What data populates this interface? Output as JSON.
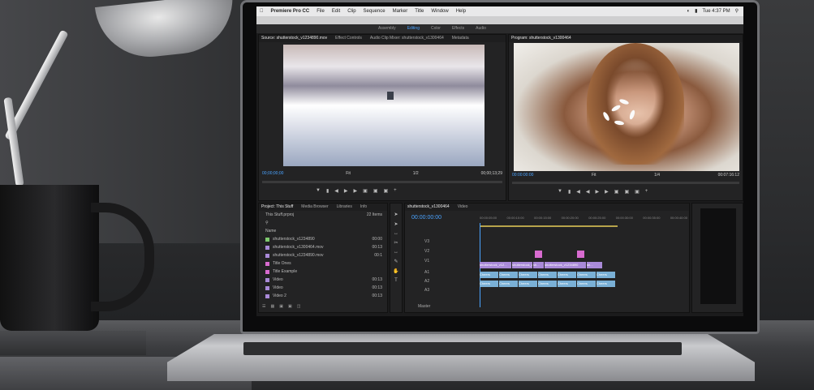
{
  "menubar": {
    "apple": "",
    "app_name": "Premiere Pro CC",
    "menus": [
      "File",
      "Edit",
      "Clip",
      "Sequence",
      "Marker",
      "Title",
      "Window",
      "Help"
    ],
    "clock": "Tue 4:37 PM"
  },
  "workspace_tabs": [
    "Assembly",
    "Editing",
    "Color",
    "Effects",
    "Audio"
  ],
  "source_monitor": {
    "tabs": [
      "Source: shutterstock_v1234890.mov",
      "Effect Controls",
      "Audio Clip Mixer: shutterstock_v1300464",
      "Metadata"
    ],
    "timecode_in": "00;00;00;00",
    "fit": "Fit",
    "zoom": "1/2",
    "timecode_out": "00;00;13;29"
  },
  "program_monitor": {
    "tabs": [
      "Program: shutterstock_v1300464"
    ],
    "timecode_in": "00:00:00:00",
    "fit": "Fit",
    "zoom": "1/4",
    "timecode_out": "00:07:16:12"
  },
  "project_panel": {
    "tabs": [
      "Project: This Stuff",
      "Media Browser",
      "Libraries",
      "Info"
    ],
    "project_file": "This Stuff.prproj",
    "item_count": "22 Items",
    "column_name": "Name",
    "items": [
      {
        "name": "shutterstock_v1234890",
        "dur": "00:00",
        "color": "#7ec96e"
      },
      {
        "name": "shutterstock_v1300464.mov",
        "dur": "00:13",
        "color": "#a98ad8"
      },
      {
        "name": "shutterstock_v1234890.mov",
        "dur": "00:1",
        "color": "#a98ad8"
      },
      {
        "name": "Title Ones",
        "dur": "",
        "color": "#d86bd0"
      },
      {
        "name": "Title Example",
        "dur": "",
        "color": "#d86bd0"
      },
      {
        "name": "Video",
        "dur": "00:13",
        "color": "#a98ad8"
      },
      {
        "name": "Video",
        "dur": "00:13",
        "color": "#a98ad8"
      },
      {
        "name": "Video 2",
        "dur": "00:13",
        "color": "#a98ad8"
      }
    ]
  },
  "timeline": {
    "tabs": [
      "shutterstock_v1300464",
      "Video"
    ],
    "timecode": "00:00:00:00",
    "ruler": [
      "00:00:05:00",
      "00:00:10:00",
      "00:00:15:00",
      "00:00:20:00",
      "00:00:25:00",
      "00:00:30:00",
      "00:00:35:00",
      "00:00:40:00"
    ],
    "video_tracks": [
      "V3",
      "V2",
      "V1"
    ],
    "audio_tracks": [
      "A1",
      "A2",
      "A3"
    ],
    "master": "Master",
    "video_clips": [
      "shutterstock_v12...",
      "shutterstock_v13...",
      "sh...",
      "shutterstock_v1234890",
      "sh..."
    ],
    "audio_clip_label": "Cheers"
  },
  "colors": {
    "accent": "#4aa3ff",
    "video_clip": "#a98ad8",
    "audio_clip": "#7ab0d6",
    "marker": "#d86bd0"
  }
}
